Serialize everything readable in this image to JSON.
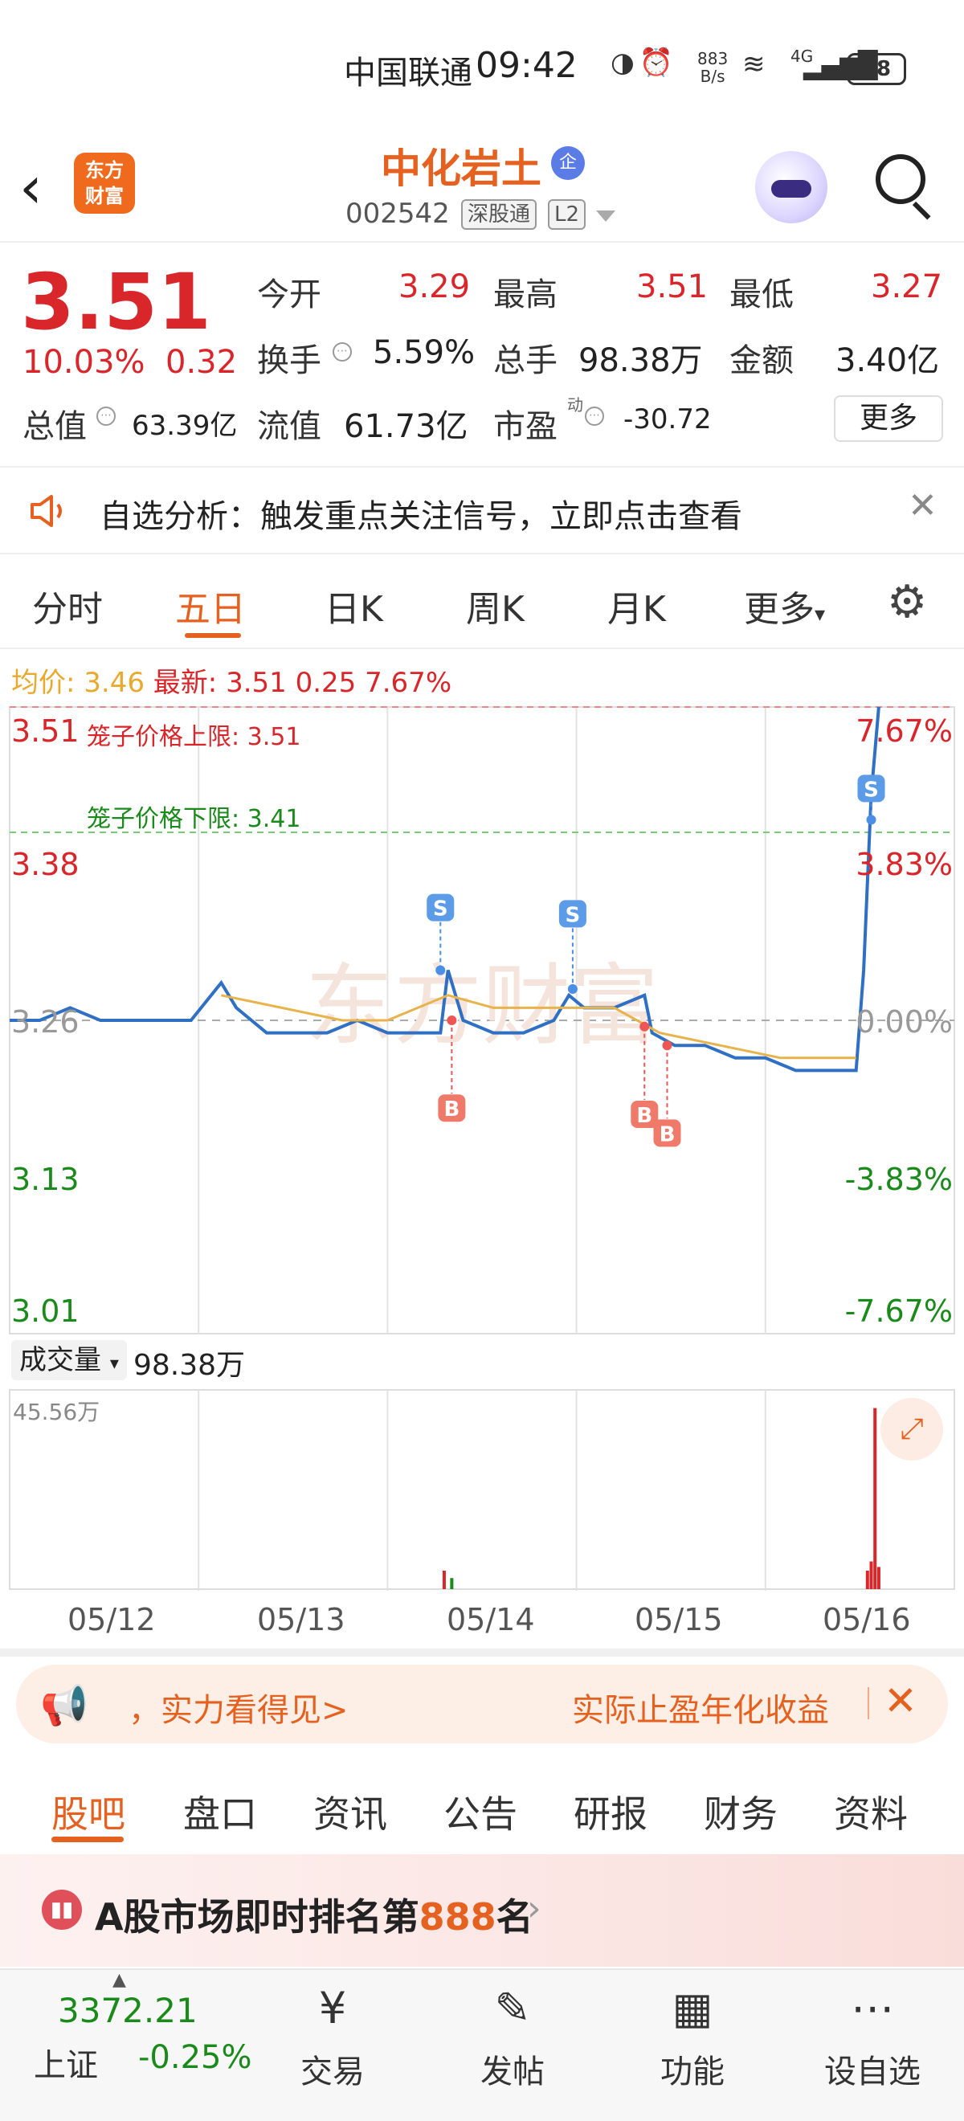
{
  "status_bar": {
    "carrier": "中国联通",
    "time": "09:42",
    "net_speed_top": "883",
    "net_speed_bottom": "B/s",
    "signal_label": "4G",
    "battery": "28"
  },
  "header": {
    "logo_line1": "东方",
    "logo_line2": "财富",
    "stock_name": "中化岩土",
    "badge": "企",
    "code": "002542",
    "tag1": "深股通",
    "tag2": "L2"
  },
  "quote": {
    "price": "3.51",
    "change_pct": "10.03%",
    "change_amt": "0.32",
    "open_label": "今开",
    "open": "3.29",
    "high_label": "最高",
    "high": "3.51",
    "low_label": "最低",
    "low": "3.27",
    "turnover_label": "换手",
    "turnover": "5.59%",
    "volume_label": "总手",
    "volume": "98.38万",
    "amount_label": "金额",
    "amount": "3.40亿",
    "total_mv_label": "总值",
    "total_mv": "63.39亿",
    "float_mv_label": "流值",
    "float_mv": "61.73亿",
    "pe_label": "市盈",
    "pe_sup": "动",
    "pe": "-30.72",
    "more_button": "更多"
  },
  "notice": {
    "text": "自选分析：触发重点关注信号，立即点击查看"
  },
  "chart_tabs": {
    "items": [
      "分时",
      "五日",
      "日K",
      "周K",
      "月K",
      "更多"
    ],
    "active": "五日"
  },
  "chart_legend": {
    "avg_label": "均价:",
    "avg_value": "3.46",
    "latest_label": "最新:",
    "latest_value": "3.51",
    "latest_change": "0.25",
    "latest_pct": "7.67%"
  },
  "chart_annotations": {
    "upper_limit": "笼子价格上限: 3.51",
    "lower_limit": "笼子价格下限: 3.41",
    "buy_marker": "B",
    "sell_marker": "S",
    "watermark": "东方财富"
  },
  "chart_data": {
    "type": "line",
    "title": "",
    "x_dates": [
      "05/12",
      "05/13",
      "05/14",
      "05/15",
      "05/16"
    ],
    "y_left_ticks": [
      "3.51",
      "3.38",
      "3.26",
      "3.13",
      "3.01"
    ],
    "y_right_ticks": [
      "7.67%",
      "3.83%",
      "0.00%",
      "-3.83%",
      "-7.67%"
    ],
    "ylim": [
      3.01,
      3.51
    ],
    "prev_close": 3.26,
    "series": [
      {
        "name": "",
        "color": "#2f6fc4",
        "points": [
          [
            0.0,
            3.26
          ],
          [
            0.04,
            3.26
          ],
          [
            0.08,
            3.27
          ],
          [
            0.12,
            3.26
          ],
          [
            0.16,
            3.26
          ],
          [
            0.2,
            3.26
          ],
          [
            0.24,
            3.26
          ],
          [
            0.28,
            3.29
          ],
          [
            0.3,
            3.27
          ],
          [
            0.34,
            3.25
          ],
          [
            0.38,
            3.25
          ],
          [
            0.42,
            3.25
          ],
          [
            0.46,
            3.26
          ],
          [
            0.5,
            3.25
          ],
          [
            0.54,
            3.25
          ],
          [
            0.57,
            3.25
          ],
          [
            0.58,
            3.3
          ],
          [
            0.6,
            3.26
          ],
          [
            0.64,
            3.25
          ],
          [
            0.68,
            3.25
          ],
          [
            0.72,
            3.26
          ],
          [
            0.74,
            3.28
          ],
          [
            0.76,
            3.27
          ],
          [
            0.8,
            3.27
          ],
          [
            0.84,
            3.28
          ],
          [
            0.85,
            3.25
          ],
          [
            0.88,
            3.24
          ],
          [
            0.92,
            3.24
          ],
          [
            0.96,
            3.23
          ],
          [
            1.0,
            3.23
          ],
          [
            1.04,
            3.22
          ],
          [
            1.08,
            3.22
          ],
          [
            1.12,
            3.22
          ],
          [
            1.13,
            3.3
          ],
          [
            1.14,
            3.44
          ],
          [
            1.15,
            3.51
          ]
        ]
      },
      {
        "name": "",
        "color": "#e8b34a",
        "points": [
          [
            0.28,
            3.28
          ],
          [
            0.36,
            3.27
          ],
          [
            0.44,
            3.26
          ],
          [
            0.5,
            3.26
          ],
          [
            0.58,
            3.28
          ],
          [
            0.64,
            3.27
          ],
          [
            0.72,
            3.27
          ],
          [
            0.8,
            3.27
          ],
          [
            0.86,
            3.25
          ],
          [
            0.94,
            3.24
          ],
          [
            1.02,
            3.23
          ],
          [
            1.12,
            3.23
          ]
        ]
      }
    ],
    "volume_label": "成交量",
    "volume_total": "98.38万",
    "volume_max": "45.56万"
  },
  "ad_banner": {
    "text1": "，实力看得见>",
    "text2": "实际止盈年化收益"
  },
  "sub_tabs": {
    "items": [
      "股吧",
      "盘口",
      "资讯",
      "公告",
      "研报",
      "财务",
      "资料"
    ],
    "active": "股吧"
  },
  "rank": {
    "prefix": "A股市场即时排名第",
    "number": "888",
    "suffix": "名"
  },
  "bottom_nav": {
    "index_value": "3372.21",
    "index_name": "上证",
    "index_change": "-0.25%",
    "trade": "交易",
    "post": "发帖",
    "functions": "功能",
    "add_watch": "设自选"
  },
  "colors": {
    "accent": "#e5611f",
    "up": "#d9262a",
    "down": "#1a8a1a",
    "price_line": "#2f6fc4",
    "avg_line": "#e8b34a"
  }
}
